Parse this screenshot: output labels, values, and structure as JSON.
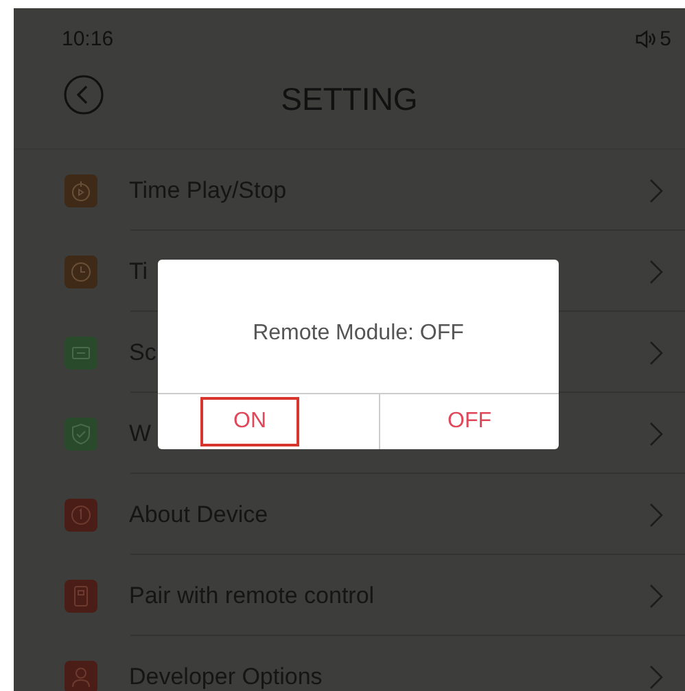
{
  "status_bar": {
    "time": "10:16",
    "volume": "5"
  },
  "header": {
    "title": "SETTING"
  },
  "items": [
    {
      "label": "Time Play/Stop",
      "kind": "timer",
      "color": "#3e2a17"
    },
    {
      "label": "Ti",
      "kind": "clock",
      "color": "#3e2a17"
    },
    {
      "label": "Sc",
      "kind": "screen",
      "color": "#2a4a2c"
    },
    {
      "label": "W",
      "kind": "shield",
      "color": "#2a4a2c"
    },
    {
      "label": "About Device",
      "kind": "info",
      "color": "#4a1e16"
    },
    {
      "label": "Pair with remote control",
      "kind": "remote",
      "color": "#4a1e16"
    },
    {
      "label": "Developer Options",
      "kind": "person",
      "color": "#4a1e16"
    }
  ],
  "dialog": {
    "message": "Remote Module: OFF",
    "buttons": [
      {
        "label": "ON",
        "selected": true
      },
      {
        "label": "OFF",
        "selected": false
      }
    ]
  }
}
